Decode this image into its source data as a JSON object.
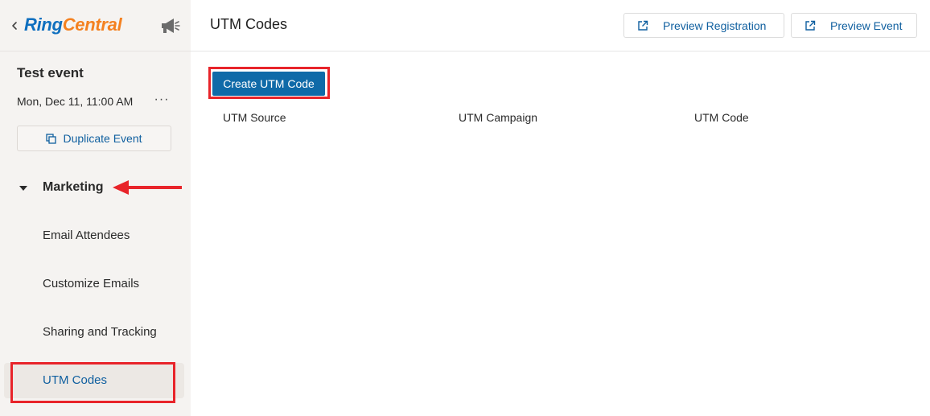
{
  "app": {
    "brand_part1": "Ring",
    "brand_part2": "Central"
  },
  "colors": {
    "accent": "#0f6aa8",
    "link": "#0f5f9f",
    "brand_blue": "#0f6fbf",
    "brand_orange": "#f48120",
    "highlight": "#e8242a"
  },
  "sidebar": {
    "event": {
      "title": "Test event",
      "date": "Mon, Dec 11, 11:00 AM",
      "more": "···"
    },
    "duplicate_label": "Duplicate Event",
    "section": {
      "label": "Marketing",
      "items": [
        {
          "label": "Email Attendees",
          "active": false
        },
        {
          "label": "Customize Emails",
          "active": false
        },
        {
          "label": "Sharing and Tracking",
          "active": false
        },
        {
          "label": "UTM Codes",
          "active": true
        }
      ]
    }
  },
  "main": {
    "title": "UTM Codes",
    "header_buttons": [
      {
        "label": "Preview Registration",
        "icon": "external-link-icon"
      },
      {
        "label": "Preview Event",
        "icon": "external-link-icon"
      }
    ],
    "create_label": "Create UTM Code",
    "table": {
      "columns": [
        "UTM Source",
        "UTM Campaign",
        "UTM Code"
      ]
    }
  }
}
